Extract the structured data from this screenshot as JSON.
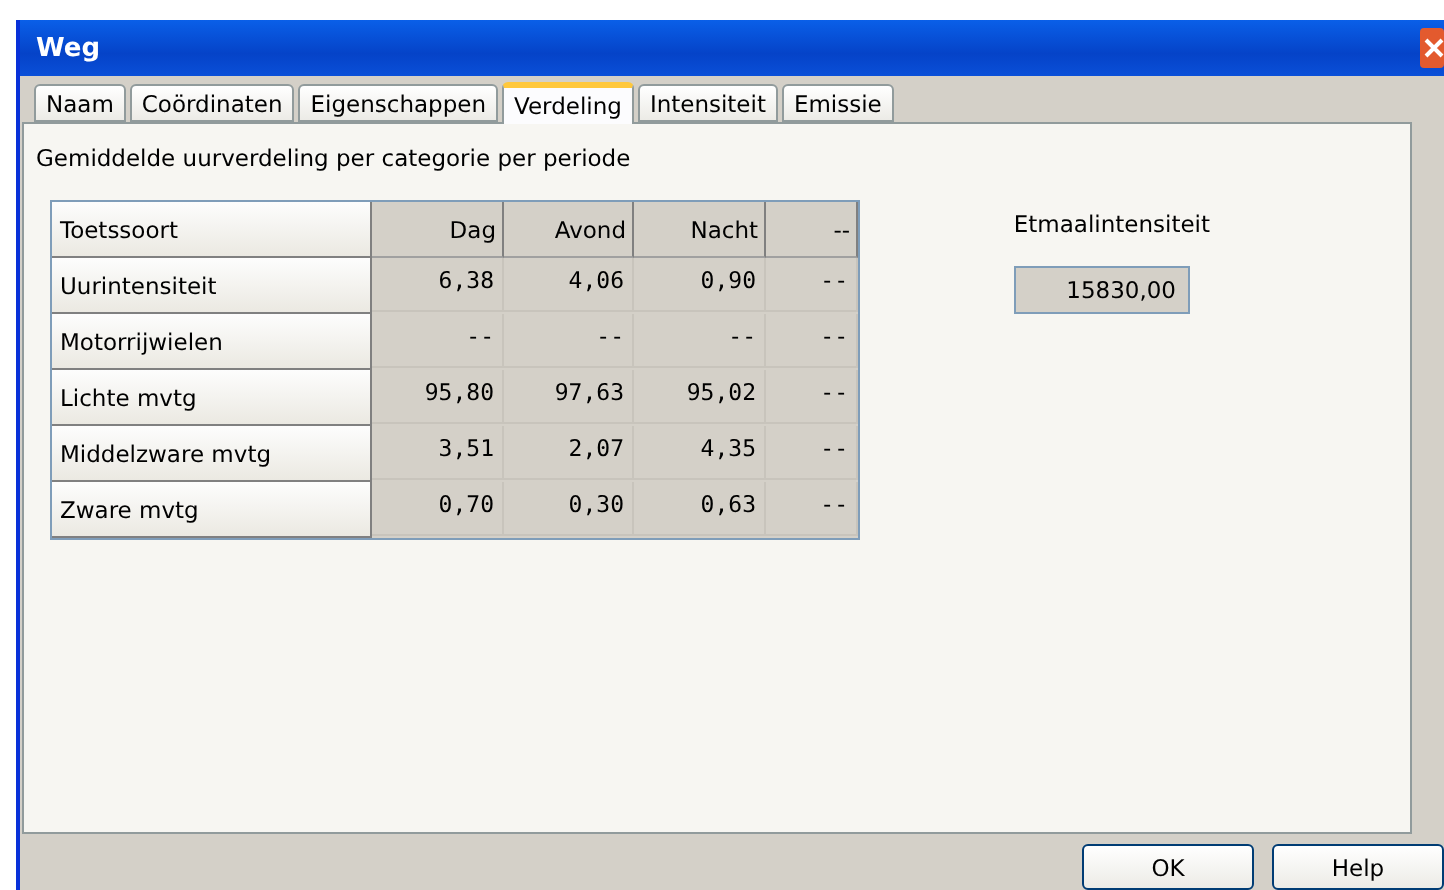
{
  "window": {
    "title": "Weg"
  },
  "tabs": [
    {
      "label": "Naam",
      "selected": false
    },
    {
      "label": "Coördinaten",
      "selected": false
    },
    {
      "label": "Eigenschappen",
      "selected": false
    },
    {
      "label": "Verdeling",
      "selected": true
    },
    {
      "label": "Intensiteit",
      "selected": false
    },
    {
      "label": "Emissie",
      "selected": false
    }
  ],
  "heading": "Gemiddelde uurverdeling per categorie per periode",
  "table": {
    "columns": [
      "Toetssoort",
      "Dag",
      "Avond",
      "Nacht",
      "--"
    ],
    "rows": [
      [
        "Uurintensiteit",
        "6,38",
        "4,06",
        "0,90",
        "--"
      ],
      [
        "Motorrijwielen",
        "--",
        "--",
        "--",
        "--"
      ],
      [
        "Lichte mvtg",
        "95,80",
        "97,63",
        "95,02",
        "--"
      ],
      [
        "Middelzware mvtg",
        "3,51",
        "2,07",
        "4,35",
        "--"
      ],
      [
        "Zware mvtg",
        "0,70",
        "0,30",
        "0,63",
        "--"
      ]
    ]
  },
  "daily": {
    "label": "Etmaalintensiteit",
    "value": "15830,00"
  },
  "buttons": [
    "OK",
    "Help"
  ]
}
